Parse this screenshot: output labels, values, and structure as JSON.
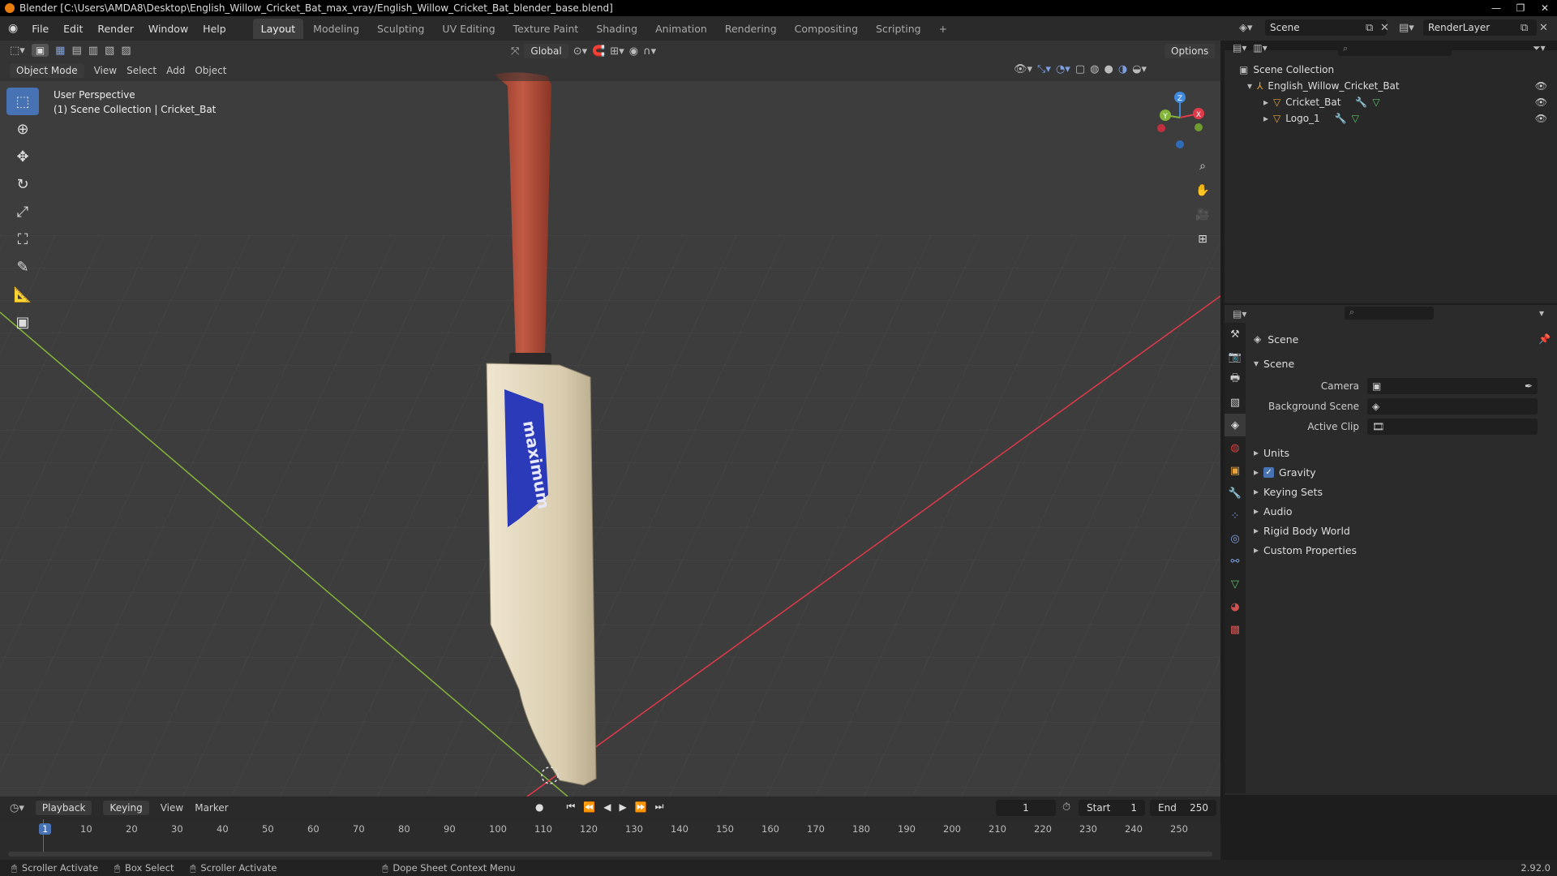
{
  "window": {
    "title": "Blender [C:\\Users\\AMDA8\\Desktop\\English_Willow_Cricket_Bat_max_vray/English_Willow_Cricket_Bat_blender_base.blend]"
  },
  "menu": [
    "File",
    "Edit",
    "Render",
    "Window",
    "Help"
  ],
  "workspaces": [
    "Layout",
    "Modeling",
    "Sculpting",
    "UV Editing",
    "Texture Paint",
    "Shading",
    "Animation",
    "Rendering",
    "Compositing",
    "Scripting"
  ],
  "active_workspace": "Layout",
  "scene_name": "Scene",
  "render_layer": "RenderLayer",
  "viewport": {
    "mode": "Object Mode",
    "menus": [
      "View",
      "Select",
      "Add",
      "Object"
    ],
    "transform_orientation": "Global",
    "options": "Options",
    "overlay_line1": "User Perspective",
    "overlay_line2": "(1) Scene Collection | Cricket_Bat",
    "bat_logo_text": "maximum",
    "gizmo": {
      "x": "X",
      "y": "Y",
      "z": "Z"
    }
  },
  "outliner": {
    "root": "Scene Collection",
    "collection": "English_Willow_Cricket_Bat",
    "objects": [
      "Cricket_Bat",
      "Logo_1"
    ]
  },
  "properties": {
    "header": "Scene",
    "section": "Scene",
    "fields": [
      {
        "label": "Camera"
      },
      {
        "label": "Background Scene"
      },
      {
        "label": "Active Clip"
      }
    ],
    "panels": [
      "Units",
      "Gravity",
      "Keying Sets",
      "Audio",
      "Rigid Body World",
      "Custom Properties"
    ],
    "gravity_checked": true
  },
  "timeline": {
    "menus": [
      "Playback",
      "Keying",
      "View",
      "Marker"
    ],
    "current_frame": "1",
    "start_label": "Start",
    "start_value": "1",
    "end_label": "End",
    "end_value": "250",
    "ticks": [
      "1",
      "10",
      "20",
      "30",
      "40",
      "50",
      "60",
      "70",
      "80",
      "90",
      "100",
      "110",
      "120",
      "130",
      "140",
      "150",
      "160",
      "170",
      "180",
      "190",
      "200",
      "210",
      "220",
      "230",
      "240",
      "250"
    ]
  },
  "statusbar": {
    "items": [
      "Scroller Activate",
      "Box Select",
      "Scroller Activate",
      "Dope Sheet Context Menu"
    ],
    "version": "2.92.0"
  },
  "colors": {
    "accent": "#4772b3",
    "x_axis": "#e0394a",
    "y_axis": "#84b43a",
    "z_axis": "#3f8adf",
    "grip": "#b34a36",
    "blade": "#d8ccb0"
  }
}
